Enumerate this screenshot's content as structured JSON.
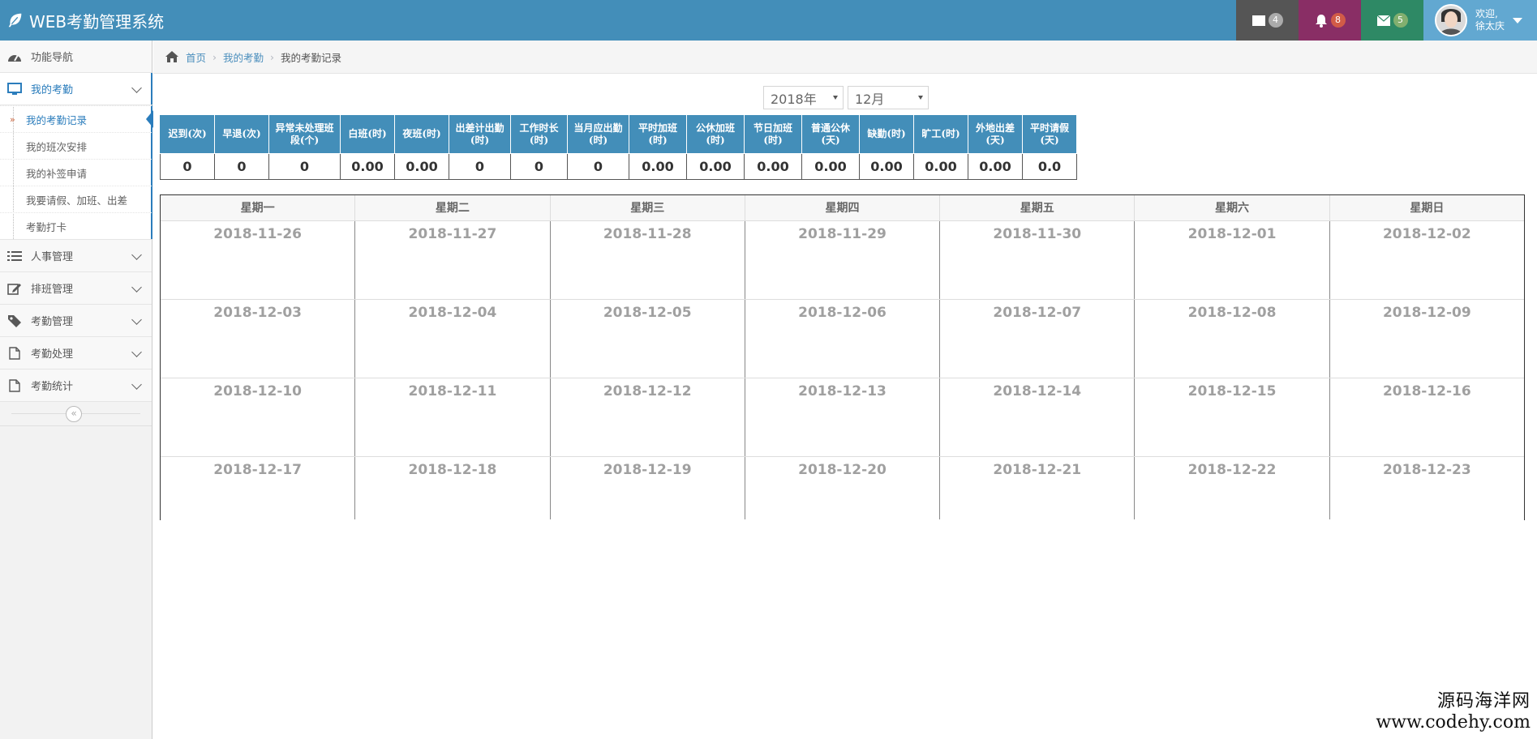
{
  "app": {
    "title": "WEB考勤管理系统"
  },
  "navbar": {
    "messages_count": "4",
    "notifications_count": "8",
    "mail_count": "5",
    "user_greeting": "欢迎,",
    "user_name": "徐太庆"
  },
  "sidebar": {
    "items": [
      {
        "label": "功能导航"
      },
      {
        "label": "我的考勤"
      },
      {
        "label": "人事管理"
      },
      {
        "label": "排班管理"
      },
      {
        "label": "考勤管理"
      },
      {
        "label": "考勤处理"
      },
      {
        "label": "考勤统计"
      }
    ],
    "submenu": [
      {
        "label": "我的考勤记录"
      },
      {
        "label": "我的班次安排"
      },
      {
        "label": "我的补签申请"
      },
      {
        "label": "我要请假、加班、出差"
      },
      {
        "label": "考勤打卡"
      }
    ]
  },
  "breadcrumb": {
    "home": "首页",
    "section": "我的考勤",
    "current": "我的考勤记录"
  },
  "filters": {
    "year": "2018年",
    "month": "12月"
  },
  "stats": {
    "headers": [
      "迟到(次)",
      "早退(次)",
      "异常未处理班段(个)",
      "白班(时)",
      "夜班(时)",
      "出差计出勤(时)",
      "工作时长(时)",
      "当月应出勤(时)",
      "平时加班(时)",
      "公休加班(时)",
      "节日加班(时)",
      "普通公休(天)",
      "缺勤(时)",
      "旷工(时)",
      "外地出差(天)",
      "平时请假(天)"
    ],
    "values": [
      "0",
      "0",
      "0",
      "0.00",
      "0.00",
      "0",
      "0",
      "0",
      "0.00",
      "0.00",
      "0.00",
      "0.00",
      "0.00",
      "0.00",
      "0.00",
      "0.0"
    ]
  },
  "calendar": {
    "weekdays": [
      "星期一",
      "星期二",
      "星期三",
      "星期四",
      "星期五",
      "星期六",
      "星期日"
    ],
    "weeks": [
      [
        "2018-11-26",
        "2018-11-27",
        "2018-11-28",
        "2018-11-29",
        "2018-11-30",
        "2018-12-01",
        "2018-12-02"
      ],
      [
        "2018-12-03",
        "2018-12-04",
        "2018-12-05",
        "2018-12-06",
        "2018-12-07",
        "2018-12-08",
        "2018-12-09"
      ],
      [
        "2018-12-10",
        "2018-12-11",
        "2018-12-12",
        "2018-12-13",
        "2018-12-14",
        "2018-12-15",
        "2018-12-16"
      ],
      [
        "2018-12-17",
        "2018-12-18",
        "2018-12-19",
        "2018-12-20",
        "2018-12-21",
        "2018-12-22",
        "2018-12-23"
      ]
    ]
  },
  "watermark": {
    "name": "源码海洋网",
    "url": "www.codehy.com"
  },
  "colors": {
    "navbar": "#438eb9",
    "accent": "#2b7dbc",
    "purple": "#892e65",
    "green": "#2e8965"
  }
}
